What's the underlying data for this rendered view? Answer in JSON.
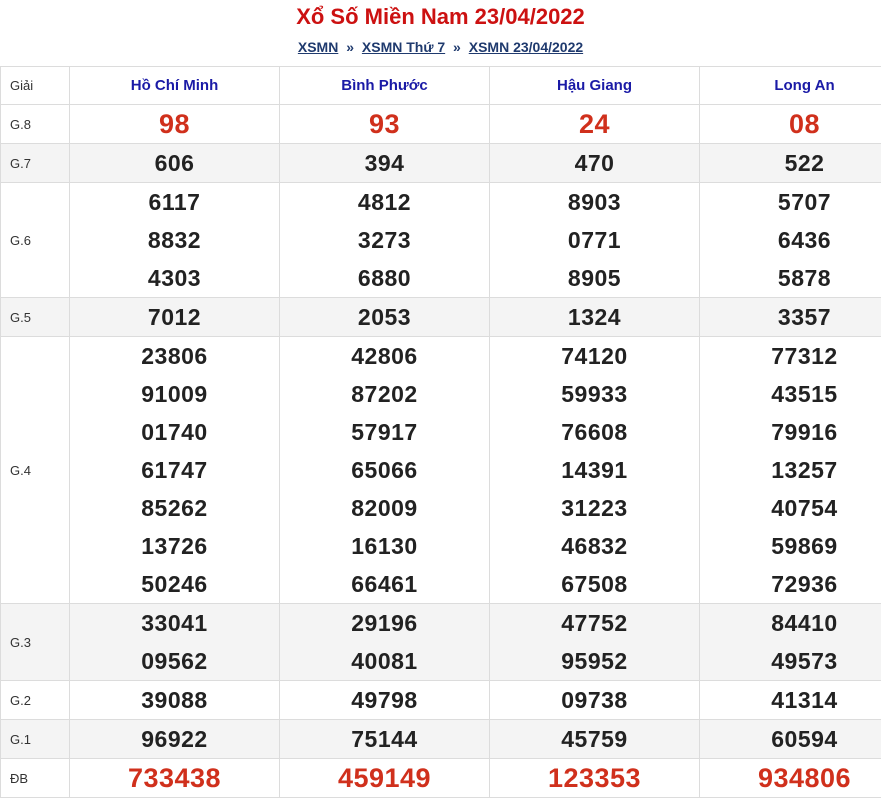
{
  "page": {
    "title": "Xổ Số Miền Nam 23/04/2022",
    "breadcrumb": [
      {
        "label": "XSMN"
      },
      {
        "label": "XSMN Thứ 7"
      },
      {
        "label": "XSMN 23/04/2022"
      }
    ],
    "breadcrumb_separator": "»"
  },
  "colors": {
    "title": "#cc1111",
    "link": "#1f3a6e",
    "header_text": "#1a1aa6",
    "highlight_number": "#d0301c",
    "number": "#222222"
  },
  "table": {
    "prize_header": "Giải",
    "provinces": [
      "Hồ Chí Minh",
      "Bình Phước",
      "Hậu Giang",
      "Long An"
    ],
    "rows": [
      {
        "prize": "G.8",
        "highlight": true,
        "big": true,
        "numbers": [
          [
            "98"
          ],
          [
            "93"
          ],
          [
            "24"
          ],
          [
            "08"
          ]
        ]
      },
      {
        "prize": "G.7",
        "highlight": false,
        "big": false,
        "numbers": [
          [
            "606"
          ],
          [
            "394"
          ],
          [
            "470"
          ],
          [
            "522"
          ]
        ]
      },
      {
        "prize": "G.6",
        "highlight": false,
        "big": false,
        "numbers": [
          [
            "6117",
            "8832",
            "4303"
          ],
          [
            "4812",
            "3273",
            "6880"
          ],
          [
            "8903",
            "0771",
            "8905"
          ],
          [
            "5707",
            "6436",
            "5878"
          ]
        ]
      },
      {
        "prize": "G.5",
        "highlight": false,
        "big": false,
        "numbers": [
          [
            "7012"
          ],
          [
            "2053"
          ],
          [
            "1324"
          ],
          [
            "3357"
          ]
        ]
      },
      {
        "prize": "G.4",
        "highlight": false,
        "big": false,
        "numbers": [
          [
            "23806",
            "91009",
            "01740",
            "61747",
            "85262",
            "13726",
            "50246"
          ],
          [
            "42806",
            "87202",
            "57917",
            "65066",
            "82009",
            "16130",
            "66461"
          ],
          [
            "74120",
            "59933",
            "76608",
            "14391",
            "31223",
            "46832",
            "67508"
          ],
          [
            "77312",
            "43515",
            "79916",
            "13257",
            "40754",
            "59869",
            "72936"
          ]
        ]
      },
      {
        "prize": "G.3",
        "highlight": false,
        "big": false,
        "numbers": [
          [
            "33041",
            "09562"
          ],
          [
            "29196",
            "40081"
          ],
          [
            "47752",
            "95952"
          ],
          [
            "84410",
            "49573"
          ]
        ]
      },
      {
        "prize": "G.2",
        "highlight": false,
        "big": false,
        "numbers": [
          [
            "39088"
          ],
          [
            "49798"
          ],
          [
            "09738"
          ],
          [
            "41314"
          ]
        ]
      },
      {
        "prize": "G.1",
        "highlight": false,
        "big": false,
        "numbers": [
          [
            "96922"
          ],
          [
            "75144"
          ],
          [
            "45759"
          ],
          [
            "60594"
          ]
        ]
      },
      {
        "prize": "ĐB",
        "highlight": true,
        "big": true,
        "numbers": [
          [
            "733438"
          ],
          [
            "459149"
          ],
          [
            "123353"
          ],
          [
            "934806"
          ]
        ]
      }
    ]
  }
}
